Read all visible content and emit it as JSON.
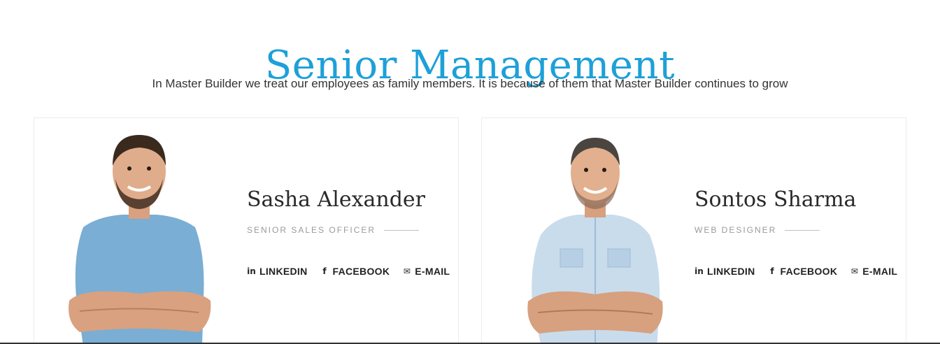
{
  "section": {
    "title": "Senior Management",
    "subtitle": "In Master Builder we treat our employees as family members. It is because of them that Master Builder continues to grow"
  },
  "members": [
    {
      "name": "Sasha Alexander",
      "role": "SENIOR SALES OFFICER",
      "links": [
        {
          "icon": "linkedin-icon",
          "glyph": "in",
          "label": "LINKEDIN"
        },
        {
          "icon": "facebook-icon",
          "glyph": "f",
          "label": "FACEBOOK"
        },
        {
          "icon": "mail-icon",
          "glyph": "✉",
          "label": "E-MAIL"
        }
      ]
    },
    {
      "name": "Sontos Sharma",
      "role": "WEB DESIGNER",
      "links": [
        {
          "icon": "linkedin-icon",
          "glyph": "in",
          "label": "LINKEDIN"
        },
        {
          "icon": "facebook-icon",
          "glyph": "f",
          "label": "FACEBOOK"
        },
        {
          "icon": "mail-icon",
          "glyph": "✉",
          "label": "E-MAIL"
        }
      ]
    }
  ],
  "colors": {
    "accent": "#1ea0d8",
    "text": "#222222",
    "muted": "#9a9a9a"
  }
}
